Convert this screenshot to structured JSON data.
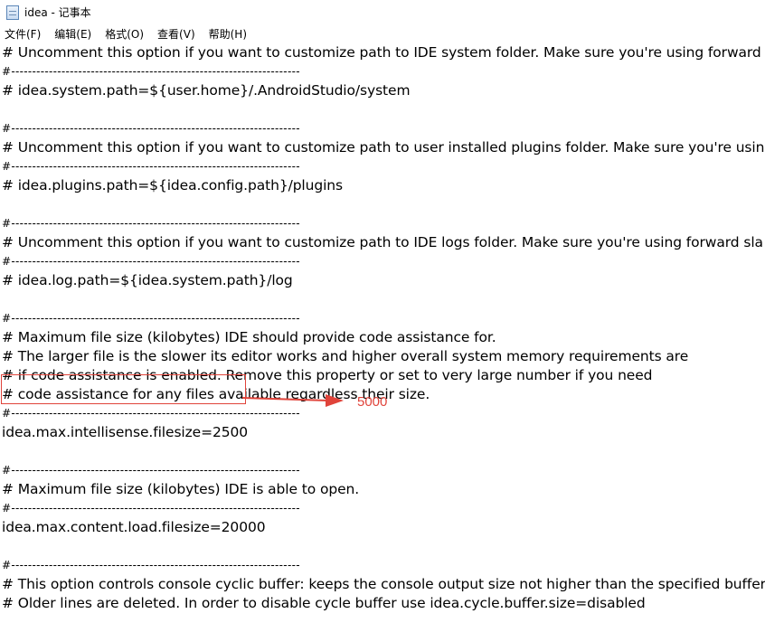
{
  "window": {
    "title": "idea - 记事本",
    "icon": "notepad-icon"
  },
  "menu": [
    {
      "label": "文件(F)"
    },
    {
      "label": "编辑(E)"
    },
    {
      "label": "格式(O)"
    },
    {
      "label": "查看(V)"
    },
    {
      "label": "帮助(H)"
    }
  ],
  "lines": [
    "# Uncomment this option if you want to customize path to IDE system folder. Make sure you're using forward",
    "#---------------------------------------------------------------------",
    "# idea.system.path=${user.home}/.AndroidStudio/system",
    "",
    "#---------------------------------------------------------------------",
    "# Uncomment this option if you want to customize path to user installed plugins folder. Make sure you're usin",
    "#---------------------------------------------------------------------",
    "# idea.plugins.path=${idea.config.path}/plugins",
    "",
    "#---------------------------------------------------------------------",
    "# Uncomment this option if you want to customize path to IDE logs folder. Make sure you're using forward sla",
    "#---------------------------------------------------------------------",
    "# idea.log.path=${idea.system.path}/log",
    "",
    "#---------------------------------------------------------------------",
    "# Maximum file size (kilobytes) IDE should provide code assistance for.",
    "# The larger file is the slower its editor works and higher overall system memory requirements are",
    "# if code assistance is enabled. Remove this property or set to very large number if you need",
    "# code assistance for any files available regardless their size.",
    "#---------------------------------------------------------------------",
    "idea.max.intellisense.filesize=2500",
    "",
    "#---------------------------------------------------------------------",
    "# Maximum file size (kilobytes) IDE is able to open.",
    "#---------------------------------------------------------------------",
    "idea.max.content.load.filesize=20000",
    "",
    "#---------------------------------------------------------------------",
    "# This option controls console cyclic buffer: keeps the console output size not higher than the specified buffer",
    "# Older lines are deleted. In order to disable cycle buffer use idea.cycle.buffer.size=disabled"
  ],
  "annotation": {
    "text": "5000",
    "color": "#e0433a"
  }
}
